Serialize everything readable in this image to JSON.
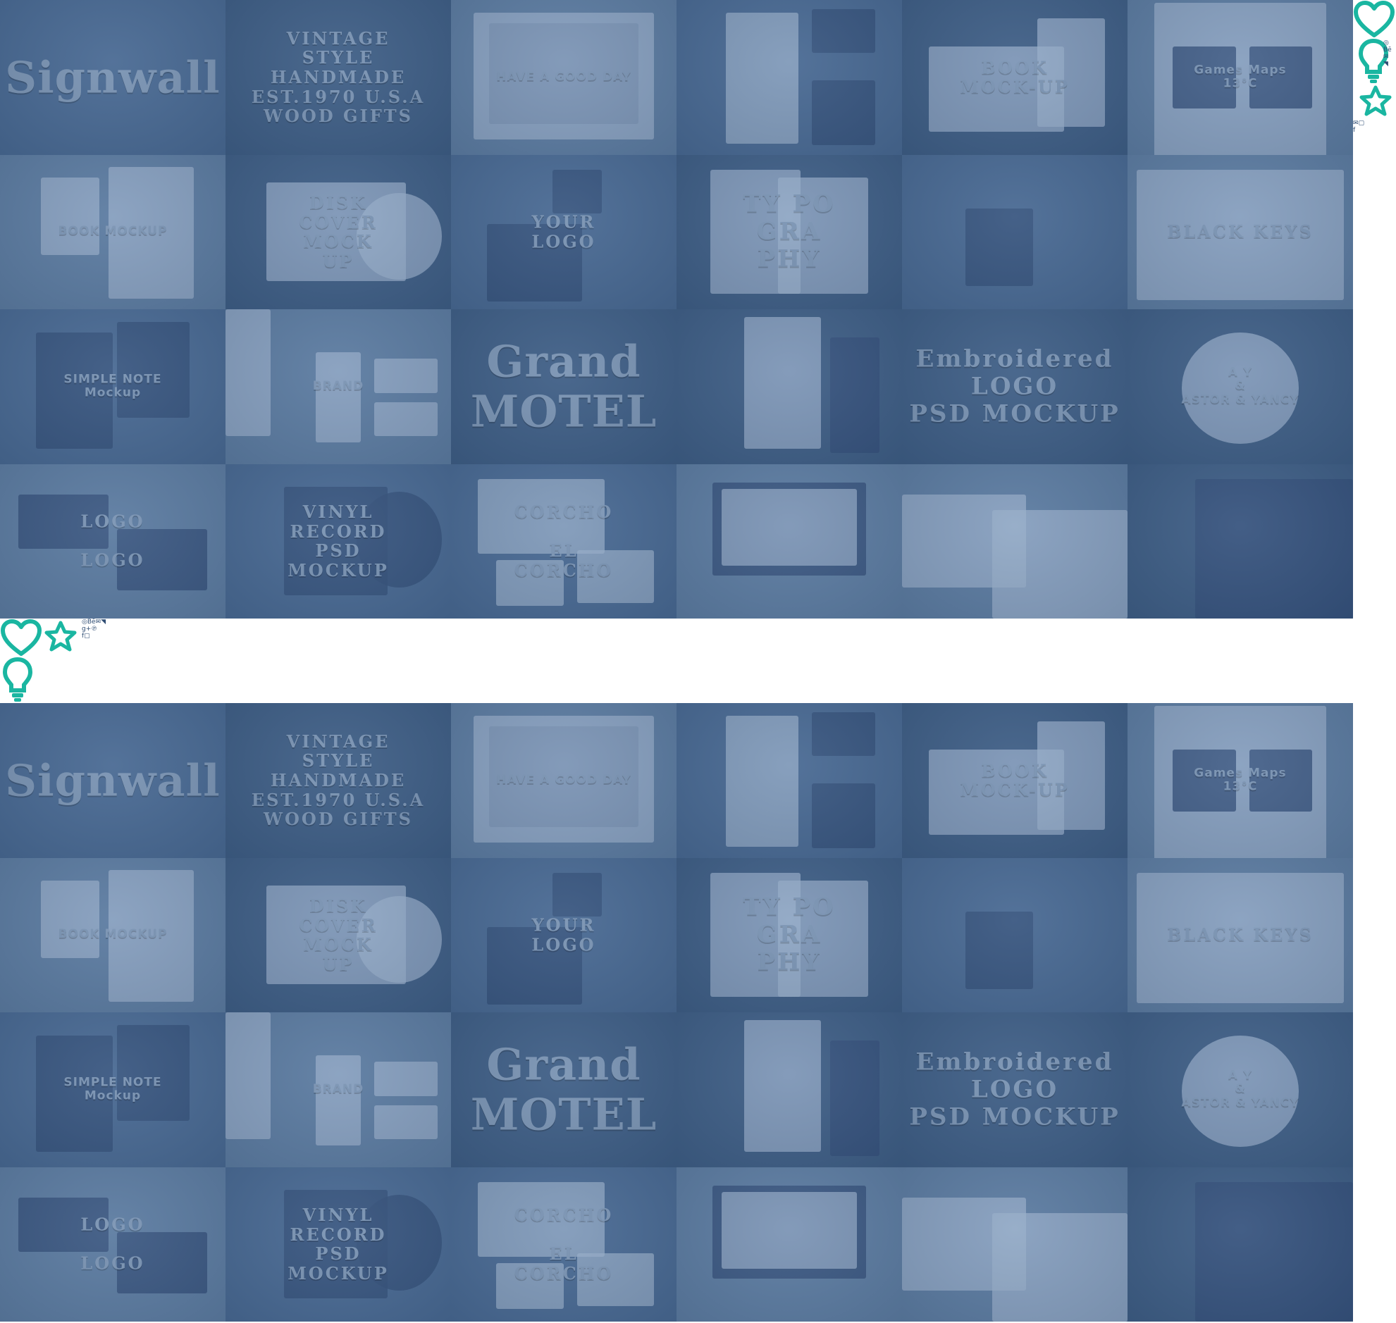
{
  "colors": {
    "overlay": "#42638c",
    "accent_teal": "#1ab6a1",
    "background": "#ffffff"
  },
  "icons": [
    "heart-icon",
    "lightbulb-icon",
    "star-icon"
  ],
  "social_icons": [
    "dribbble-icon",
    "behance-icon",
    "email-icon",
    "twitter-icon",
    "google-plus-icon",
    "pinterest-icon",
    "facebook-icon",
    "instagram-icon"
  ],
  "gallery": {
    "tiles": [
      {
        "title": "Signwall"
      },
      {
        "title": "VINTAGE\nSTYLE\nHANDMADE\nEST.1970 U.S.A\nWOOD GIFTS"
      },
      {
        "title": "HAVE A GOOD DAY"
      },
      {
        "title": ""
      },
      {
        "title": "BOOK\nMOCK-UP"
      },
      {
        "title": "Games      Maps\n13°C"
      },
      {
        "title": "BOOK MOCKUP"
      },
      {
        "title": "DISK\nCOVER\nMOCK\nUP"
      },
      {
        "title": "YOUR\nLOGO"
      },
      {
        "title": "TY PO\nGRA\nPHY"
      },
      {
        "title": ""
      },
      {
        "title": "BLACK KEYS"
      },
      {
        "title": "SIMPLE NOTE\nMockup"
      },
      {
        "title": "BRAND"
      },
      {
        "title": "Grand\nMOTEL"
      },
      {
        "title": ""
      },
      {
        "title": "Embroidered\nLOGO\nPSD MOCKUP"
      },
      {
        "title": "A  Y\n&\nASTOR & YANCY"
      },
      {
        "title": "LOGO\n\nLOGO"
      },
      {
        "title": "VINYL\nRECORD\nPSD\nMOCKUP"
      },
      {
        "title": "CORCHO\n\nEL\nCORCHO"
      },
      {
        "title": ""
      },
      {
        "title": ""
      },
      {
        "title": ""
      }
    ]
  }
}
